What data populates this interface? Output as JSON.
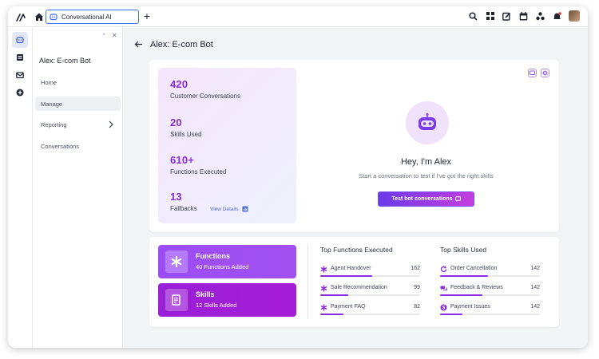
{
  "topbar": {
    "tab_label": "Conversational AI",
    "new_tab_label": "+",
    "icons": [
      "search-icon",
      "grid-icon",
      "compose-icon",
      "calendar-icon",
      "apps-icon",
      "notification-icon"
    ]
  },
  "rail": {
    "icons": [
      "chat-bot-icon",
      "catalog-icon",
      "inbox-icon",
      "add-circle-icon"
    ]
  },
  "nav": {
    "title": "Alex: E-com Bot",
    "items": [
      {
        "label": "Home"
      },
      {
        "label": "Manage"
      },
      {
        "label": "Reporting"
      },
      {
        "label": "Conversations"
      }
    ],
    "active_item": "Manage"
  },
  "page": {
    "title": "Alex: E-com Bot"
  },
  "stats": [
    {
      "value": "420",
      "label": "Customer Conversations"
    },
    {
      "value": "20",
      "label": "Skills Used"
    },
    {
      "value": "610+",
      "label": "Functions Executed"
    },
    {
      "value": "13",
      "label": "Fallbacks"
    }
  ],
  "view_details_label": "View Details",
  "intro": {
    "greeting": "Hey, I'm Alex",
    "subtitle": "Start a conversation to test if I've got the right skills",
    "button_label": "Test bot conversations"
  },
  "tiles": {
    "functions": {
      "title": "Functions",
      "subtitle": "40 Functions Added"
    },
    "skills": {
      "title": "Skills",
      "subtitle": "12 Skills Added"
    }
  },
  "top_functions": {
    "title": "Top Functions Executed",
    "items": [
      {
        "label": "Agent Handover",
        "value": "162",
        "fraction": 0.52
      },
      {
        "label": "Sale Recommendation",
        "value": "99",
        "fraction": 0.28
      },
      {
        "label": "Payment FAQ",
        "value": "82",
        "fraction": 0.23
      }
    ]
  },
  "top_skills": {
    "title": "Top Skills Used",
    "items": [
      {
        "label": "Order Cancellation",
        "value": "142",
        "fraction": 0.48
      },
      {
        "label": "Feedback & Reviews",
        "value": "142",
        "fraction": 0.42
      },
      {
        "label": "Payment Issues",
        "value": "142",
        "fraction": 0.22
      }
    ]
  },
  "colors": {
    "accent": "#8b2bd9",
    "functions_tile": "#9b4ef5",
    "skills_tile": "#9a1fd6",
    "tab_border": "#3b6ff5"
  }
}
